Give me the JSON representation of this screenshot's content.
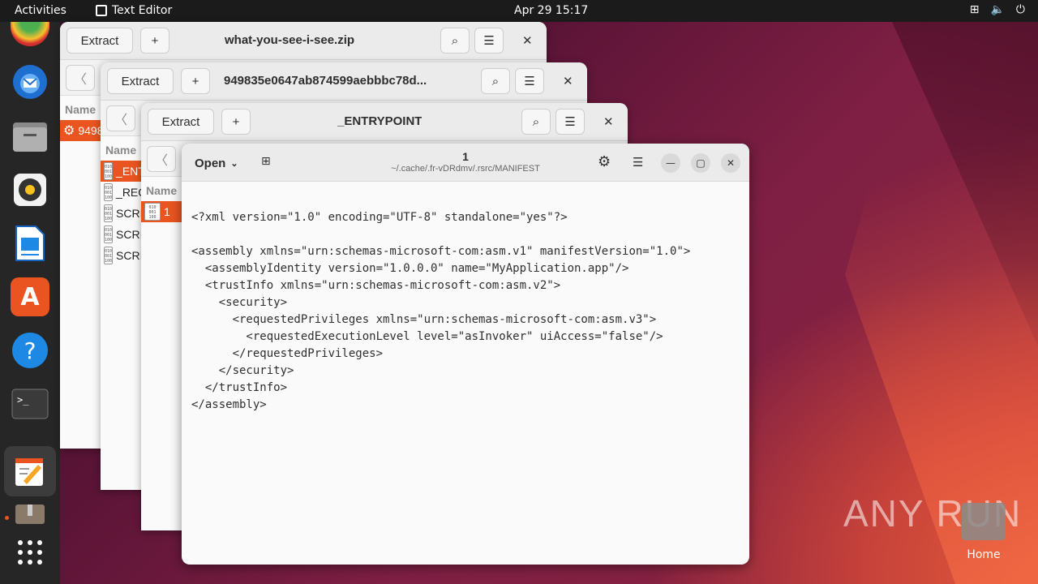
{
  "topbar": {
    "activities": "Activities",
    "app_name": "Text Editor",
    "clock": "Apr 29  15:17",
    "tray_icons": [
      "network-icon",
      "volume-icon",
      "power-icon"
    ]
  },
  "dock": {
    "items": [
      "chrome",
      "thunderbird",
      "files",
      "rhythmbox",
      "libreoffice-writer",
      "app-center",
      "help",
      "terminal",
      "text-editor",
      "archive-manager",
      "show-apps"
    ]
  },
  "win1": {
    "extract": "Extract",
    "title": "what-you-see-i-see.zip",
    "col_name": "Name",
    "rows": [
      "949835e0647ab874599aebbbc78d..."
    ]
  },
  "win2": {
    "extract": "Extract",
    "title": "949835e0647ab874599aebbbc78d...",
    "col_name": "Name",
    "rows": [
      "_ENTRYPOINT",
      "_REQUEST",
      "SCRIPT",
      "SCRIPT",
      "SCRIPT"
    ]
  },
  "win3": {
    "extract": "Extract",
    "title": "_ENTRYPOINT",
    "col_name": "Name",
    "rows": [
      "1"
    ]
  },
  "editor": {
    "open_label": "Open",
    "title": "1",
    "path": "~/.cache/.fr-vDRdmv/.rsrc/MANIFEST",
    "lines": [
      "<?xml version=\"1.0\" encoding=\"UTF-8\" standalone=\"yes\"?>",
      "",
      "<assembly xmlns=\"urn:schemas-microsoft-com:asm.v1\" manifestVersion=\"1.0\">",
      "  <assemblyIdentity version=\"1.0.0.0\" name=\"MyApplication.app\"/>",
      "  <trustInfo xmlns=\"urn:schemas-microsoft-com:asm.v2\">",
      "    <security>",
      "      <requestedPrivileges xmlns=\"urn:schemas-microsoft-com:asm.v3\">",
      "        <requestedExecutionLevel level=\"asInvoker\" uiAccess=\"false\"/>",
      "      </requestedPrivileges>",
      "    </security>",
      "  </trustInfo>",
      "</assembly>"
    ]
  },
  "watermark": "ANY RUN",
  "desktop_home": "Home",
  "colors": {
    "accent": "#e95420",
    "topbar": "#1b1b1b",
    "dock": "#262626"
  }
}
